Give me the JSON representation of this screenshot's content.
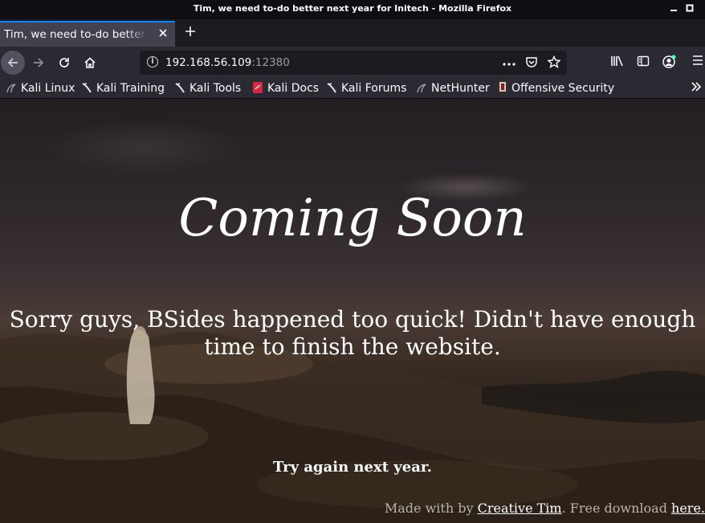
{
  "window": {
    "title": "Tim, we need to-do better next year for Initech - Mozilla Firefox"
  },
  "tabs": [
    {
      "label": "Tim, we need to-do better next year for Initech",
      "active": true
    }
  ],
  "navbar": {
    "url_host": "192.168.56.109",
    "url_port": ":12380"
  },
  "bookmarks": [
    {
      "label": "Kali Linux",
      "icon": "kali-dragon-icon"
    },
    {
      "label": "Kali Training",
      "icon": "kali-dragon-icon"
    },
    {
      "label": "Kali Tools",
      "icon": "kali-dragon-icon"
    },
    {
      "label": "Kali Docs",
      "icon": "kali-docs-icon"
    },
    {
      "label": "Kali Forums",
      "icon": "kali-dragon-icon"
    },
    {
      "label": "NetHunter",
      "icon": "kali-dragon-icon"
    },
    {
      "label": "Offensive Security",
      "icon": "offsec-icon"
    }
  ],
  "page": {
    "heading": "Coming Soon",
    "message": "Sorry guys, BSides happened too quick! Didn't have enough time to finish the website.",
    "subtext": "Try again next year.",
    "footer_prefix": "Made with by ",
    "footer_link1": "Creative Tim",
    "footer_middle": ". Free download ",
    "footer_link2": "here."
  },
  "colors": {
    "accent": "#0a84ff",
    "toolbar": "#2b2a33",
    "titlebar": "#0f0e13"
  }
}
